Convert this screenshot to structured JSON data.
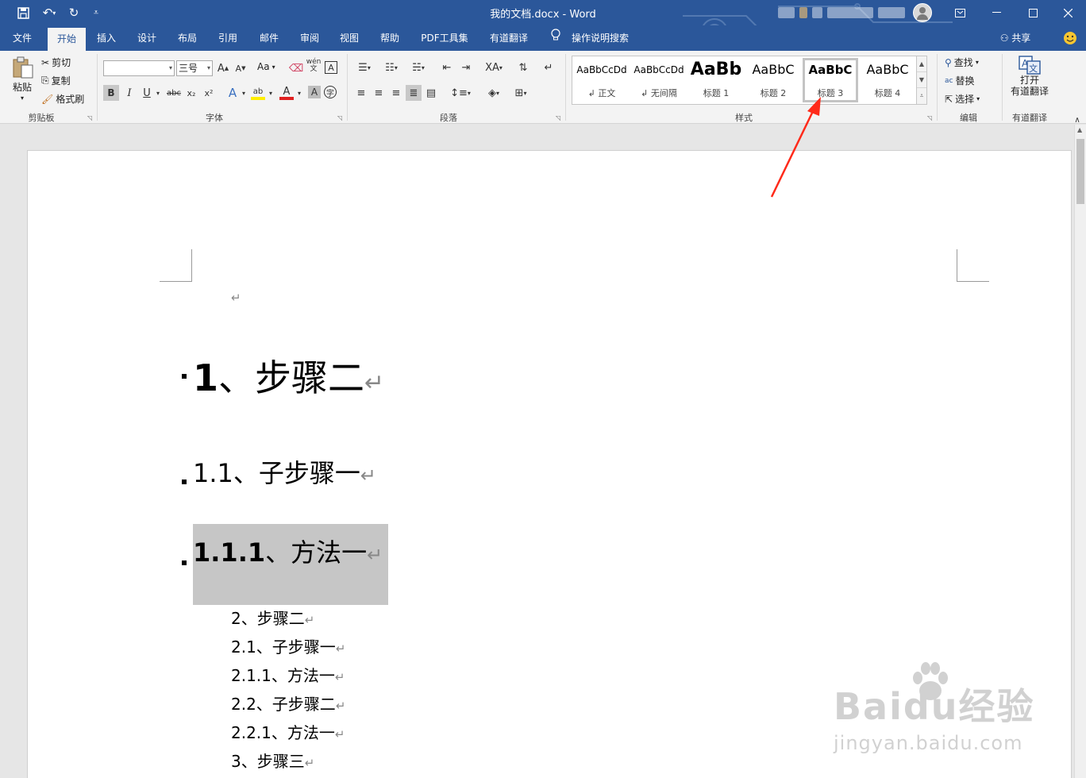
{
  "titlebar": {
    "doc_title": "我的文档.docx  -  Word",
    "qa_more": "⩡"
  },
  "tabs": [
    {
      "label": "文件",
      "active": false
    },
    {
      "label": "开始",
      "active": true
    },
    {
      "label": "插入",
      "active": false
    },
    {
      "label": "设计",
      "active": false
    },
    {
      "label": "布局",
      "active": false
    },
    {
      "label": "引用",
      "active": false
    },
    {
      "label": "邮件",
      "active": false
    },
    {
      "label": "审阅",
      "active": false
    },
    {
      "label": "视图",
      "active": false
    },
    {
      "label": "帮助",
      "active": false
    },
    {
      "label": "PDF工具集",
      "active": false
    },
    {
      "label": "有道翻译",
      "active": false
    }
  ],
  "tell_me": "操作说明搜索",
  "share": "共享",
  "ribbon": {
    "clipboard": {
      "label": "剪贴板",
      "paste": "粘贴",
      "cut": "剪切",
      "copy": "复制",
      "format_painter": "格式刷"
    },
    "font": {
      "label": "字体",
      "font_name": "",
      "font_size": "三号",
      "case_btn": "Aa",
      "phonetic": "wén",
      "bold": "B",
      "italic": "I",
      "underline": "U",
      "strike": "abc",
      "sub": "x₂",
      "sup": "x²"
    },
    "paragraph": {
      "label": "段落"
    },
    "styles": {
      "label": "样式",
      "items": [
        {
          "sample": "AaBbCcDd",
          "name": "↲ 正文",
          "size": 12,
          "bold": false
        },
        {
          "sample": "AaBbCcDd",
          "name": "↲ 无间隔",
          "size": 12,
          "bold": false
        },
        {
          "sample": "AaBb",
          "name": "标题 1",
          "size": 22,
          "bold": true
        },
        {
          "sample": "AaBbC",
          "name": "标题 2",
          "size": 16,
          "bold": false
        },
        {
          "sample": "AaBbC",
          "name": "标题 3",
          "size": 16,
          "bold": true
        },
        {
          "sample": "AaBbC",
          "name": "标题 4",
          "size": 16,
          "bold": false
        }
      ],
      "selected_index": 4
    },
    "editing": {
      "label": "编辑",
      "find": "查找",
      "replace": "替换",
      "select": "选择"
    },
    "youdao": {
      "label": "有道翻译",
      "open_line1": "打开",
      "open_line2": "有道翻译"
    }
  },
  "document": {
    "paragraphs": [
      {
        "num": "1",
        "text": "、步骤二",
        "style": "h1"
      },
      {
        "num": "1.1",
        "text": "、子步骤一",
        "style": "h2"
      },
      {
        "num": "1.1.1",
        "text": "、方法一",
        "style": "h3"
      },
      {
        "num": "",
        "text": "2、步骤二",
        "style": "body"
      },
      {
        "num": "",
        "text": "2.1、子步骤一",
        "style": "body"
      },
      {
        "num": "",
        "text": "2.1.1、方法一",
        "style": "body"
      },
      {
        "num": "",
        "text": "2.2、子步骤二",
        "style": "body"
      },
      {
        "num": "",
        "text": "2.2.1、方法一",
        "style": "body"
      },
      {
        "num": "",
        "text": "3、步骤三",
        "style": "body"
      }
    ],
    "paragraph_mark": "↵"
  },
  "watermark": {
    "brand": "Baidu经验",
    "url": "jingyan.baidu.com"
  },
  "colors": {
    "accent": "#2b579a",
    "ribbon_bg": "#f3f3f3",
    "annotation_arrow": "#ff2a1a",
    "selection": "#c6c6c6"
  },
  "icons": {
    "save": "save-icon",
    "undo": "undo-icon",
    "redo": "redo-icon",
    "lightbulb": "lightbulb-icon",
    "smiley": "smiley-icon"
  }
}
